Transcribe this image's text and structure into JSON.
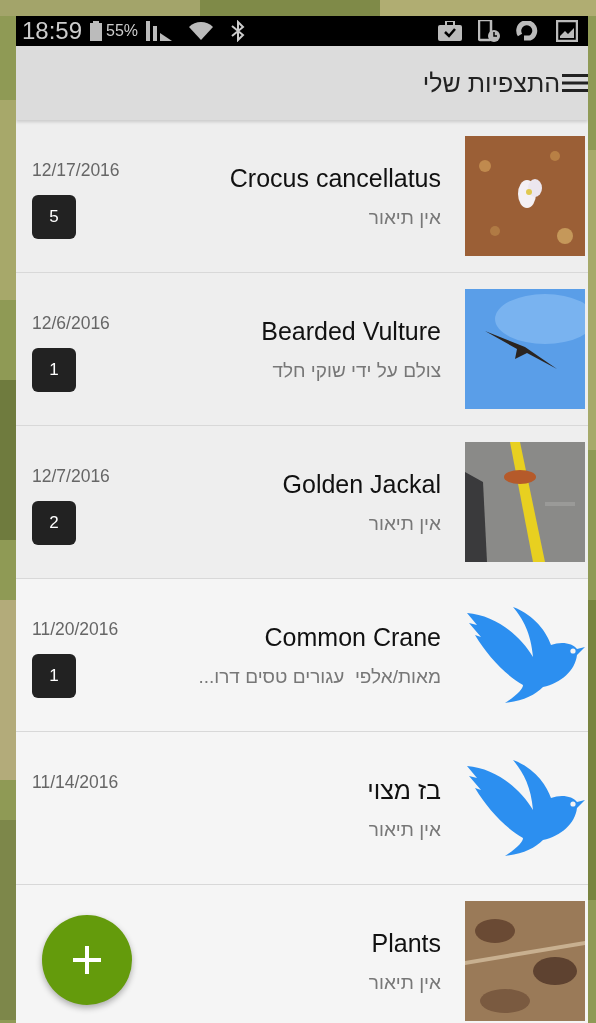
{
  "status_bar": {
    "time": "18:59",
    "battery": "55%"
  },
  "app_bar": {
    "title": "התצפיות שלי"
  },
  "observations": [
    {
      "title": "Crocus cancellatus",
      "description": "אין תיאור",
      "date": "12/17/2016",
      "count": "5"
    },
    {
      "title": "Bearded Vulture",
      "description": "צולם על ידי שוקי חלד",
      "date": "12/6/2016",
      "count": "1"
    },
    {
      "title": "Golden Jackal",
      "description": "אין תיאור",
      "date": "12/7/2016",
      "count": "2"
    },
    {
      "title": "Common Crane",
      "description": "מאות/אלפי  עגורים טסים דרו...",
      "date": "11/20/2016",
      "count": "1",
      "thumb": {
        "kind": "placeholder"
      }
    },
    {
      "title": "בז מצוי",
      "description": "אין תיאור",
      "date": "11/14/2016",
      "thumb": {
        "kind": "placeholder"
      }
    },
    {
      "title": "Plants",
      "description": "אין תיאור"
    }
  ]
}
